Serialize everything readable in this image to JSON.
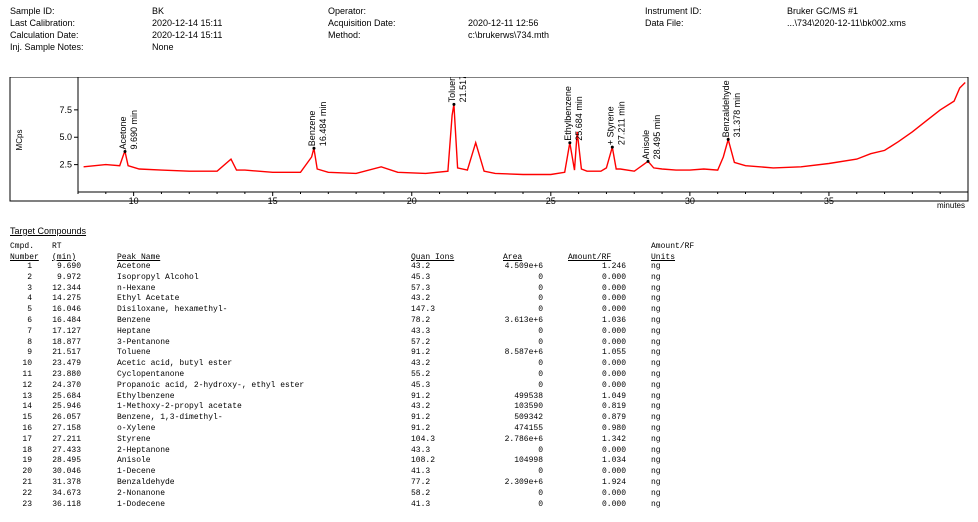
{
  "header": {
    "left": [
      {
        "label": "Sample ID:",
        "value": "BK"
      },
      {
        "label": "Last Calibration:",
        "value": "2020-12-14 15:11"
      },
      {
        "label": "Calculation Date:",
        "value": "2020-12-14 15:11"
      },
      {
        "label": "Inj. Sample Notes:",
        "value": "None"
      }
    ],
    "middle": [
      {
        "label": "Operator:",
        "value": ""
      },
      {
        "label": "Acquisition Date:",
        "value": "2020-12-11 12:56"
      },
      {
        "label": "Method:",
        "value": "c:\\brukerws\\734.mth"
      }
    ],
    "right": [
      {
        "label": "Instrument ID:",
        "value": "Bruker GC/MS #1"
      },
      {
        "label": "Data File:",
        "value": "...\\734\\2020-12-11\\bk002.xms"
      }
    ]
  },
  "chart_data": {
    "type": "line",
    "ylabel": "MCps",
    "xlabel": "minutes",
    "xlim": [
      8,
      40
    ],
    "ylim": [
      0,
      10.5
    ],
    "xticks": [
      10,
      15,
      20,
      25,
      30,
      35
    ],
    "yticks": [
      2.5,
      5.0,
      7.5
    ],
    "ytick_labels": [
      "2.5",
      "5.0",
      "7.5"
    ],
    "series": [
      {
        "color": "#ff0000",
        "x": [
          8.2,
          9.0,
          9.5,
          9.65,
          9.69,
          9.8,
          10.2,
          11.0,
          12.0,
          13.0,
          13.5,
          13.7,
          14.0,
          15.0,
          16.0,
          16.4,
          16.48,
          16.6,
          17.0,
          18.0,
          18.9,
          19.5,
          20.5,
          21.3,
          21.45,
          21.517,
          21.65,
          22.0,
          22.3,
          22.6,
          23.0,
          24.0,
          25.0,
          25.5,
          25.684,
          25.85,
          25.95,
          26.1,
          26.3,
          26.8,
          27.0,
          27.211,
          27.35,
          27.5,
          28.0,
          28.495,
          28.7,
          29.0,
          29.5,
          30.0,
          30.5,
          31.0,
          31.2,
          31.378,
          31.6,
          32.0,
          33.0,
          34.0,
          35.0,
          36.0,
          36.5,
          37.0,
          37.5,
          38.0,
          38.5,
          39.0,
          39.5,
          39.7,
          39.9
        ],
        "y": [
          2.3,
          2.5,
          2.4,
          3.5,
          3.7,
          2.4,
          2.1,
          2.0,
          1.9,
          1.9,
          3.0,
          2.0,
          2.0,
          1.8,
          1.8,
          3.2,
          4.0,
          2.1,
          1.8,
          1.7,
          2.3,
          1.8,
          1.7,
          1.9,
          7.0,
          8.0,
          2.2,
          2.0,
          4.5,
          1.9,
          1.7,
          1.6,
          1.6,
          1.8,
          4.5,
          2.0,
          5.5,
          2.1,
          1.9,
          1.9,
          2.2,
          4.1,
          2.1,
          2.1,
          1.9,
          2.8,
          2.2,
          2.1,
          2.0,
          2.0,
          2.1,
          2.0,
          3.2,
          4.8,
          2.7,
          2.4,
          2.2,
          2.3,
          2.6,
          3.0,
          3.5,
          3.8,
          4.6,
          5.5,
          6.5,
          7.5,
          8.3,
          9.5,
          10.0
        ]
      }
    ],
    "annotations": [
      {
        "name": "Acetone",
        "rt": "9.690 min",
        "x": 9.69,
        "y": 3.7
      },
      {
        "name": "Benzene",
        "rt": "16.484 min",
        "x": 16.484,
        "y": 4.0
      },
      {
        "name": "Toluene",
        "rt": "21.517 min",
        "x": 21.517,
        "y": 8.0
      },
      {
        "name": "Ethylbenzene",
        "rt": "25.684 min",
        "x": 25.684,
        "y": 4.5
      },
      {
        "name": "+ Styrene",
        "rt": "27.211 min",
        "x": 27.211,
        "y": 4.1
      },
      {
        "name": "Anisole",
        "rt": "28.495 min",
        "x": 28.495,
        "y": 2.8
      },
      {
        "name": "Benzaldehyde",
        "rt": "31.378 min",
        "x": 31.378,
        "y": 4.8
      }
    ]
  },
  "section_title": "Target Compounds",
  "columns": {
    "top": [
      "Cmpd.",
      "RT",
      "",
      "",
      "",
      "Amount/RF"
    ],
    "bottom": [
      "Number",
      "(min)",
      "Peak Name",
      "Quan Ions",
      "Area",
      "Amount/RF",
      "Units"
    ]
  },
  "rows": [
    {
      "n": "1",
      "rt": "9.690",
      "name": "Acetone",
      "ions": "43.2",
      "area": "4.509e+6",
      "amt": "1.246",
      "unit": "ng"
    },
    {
      "n": "2",
      "rt": "9.972",
      "name": "Isopropyl Alcohol",
      "ions": "45.3",
      "area": "0",
      "amt": "0.000",
      "unit": "ng"
    },
    {
      "n": "3",
      "rt": "12.344",
      "name": "n-Hexane",
      "ions": "57.3",
      "area": "0",
      "amt": "0.000",
      "unit": "ng"
    },
    {
      "n": "4",
      "rt": "14.275",
      "name": "Ethyl Acetate",
      "ions": "43.2",
      "area": "0",
      "amt": "0.000",
      "unit": "ng"
    },
    {
      "n": "5",
      "rt": "16.046",
      "name": "Disiloxane, hexamethyl-",
      "ions": "147.3",
      "area": "0",
      "amt": "0.000",
      "unit": "ng"
    },
    {
      "n": "6",
      "rt": "16.484",
      "name": "Benzene",
      "ions": "78.2",
      "area": "3.613e+6",
      "amt": "1.036",
      "unit": "ng"
    },
    {
      "n": "7",
      "rt": "17.127",
      "name": "Heptane",
      "ions": "43.3",
      "area": "0",
      "amt": "0.000",
      "unit": "ng"
    },
    {
      "n": "8",
      "rt": "18.877",
      "name": "3-Pentanone",
      "ions": "57.2",
      "area": "0",
      "amt": "0.000",
      "unit": "ng"
    },
    {
      "n": "9",
      "rt": "21.517",
      "name": "Toluene",
      "ions": "91.2",
      "area": "8.587e+6",
      "amt": "1.055",
      "unit": "ng"
    },
    {
      "n": "10",
      "rt": "23.479",
      "name": "Acetic acid, butyl ester",
      "ions": "43.2",
      "area": "0",
      "amt": "0.000",
      "unit": "ng"
    },
    {
      "n": "11",
      "rt": "23.880",
      "name": "Cyclopentanone",
      "ions": "55.2",
      "area": "0",
      "amt": "0.000",
      "unit": "ng"
    },
    {
      "n": "12",
      "rt": "24.370",
      "name": "Propanoic acid, 2-hydroxy-, ethyl ester",
      "ions": "45.3",
      "area": "0",
      "amt": "0.000",
      "unit": "ng"
    },
    {
      "n": "13",
      "rt": "25.684",
      "name": "Ethylbenzene",
      "ions": "91.2",
      "area": "499538",
      "amt": "1.049",
      "unit": "ng"
    },
    {
      "n": "14",
      "rt": "25.946",
      "name": "1-Methoxy-2-propyl acetate",
      "ions": "43.2",
      "area": "103590",
      "amt": "0.819",
      "unit": "ng"
    },
    {
      "n": "15",
      "rt": "26.057",
      "name": "Benzene, 1,3-dimethyl-",
      "ions": "91.2",
      "area": "509342",
      "amt": "0.879",
      "unit": "ng"
    },
    {
      "n": "16",
      "rt": "27.158",
      "name": "o-Xylene",
      "ions": "91.2",
      "area": "474155",
      "amt": "0.980",
      "unit": "ng"
    },
    {
      "n": "17",
      "rt": "27.211",
      "name": "Styrene",
      "ions": "104.3",
      "area": "2.786e+6",
      "amt": "1.342",
      "unit": "ng"
    },
    {
      "n": "18",
      "rt": "27.433",
      "name": "2-Heptanone",
      "ions": "43.3",
      "area": "0",
      "amt": "0.000",
      "unit": "ng"
    },
    {
      "n": "19",
      "rt": "28.495",
      "name": "Anisole",
      "ions": "108.2",
      "area": "104998",
      "amt": "1.034",
      "unit": "ng"
    },
    {
      "n": "20",
      "rt": "30.046",
      "name": "1-Decene",
      "ions": "41.3",
      "area": "0",
      "amt": "0.000",
      "unit": "ng"
    },
    {
      "n": "21",
      "rt": "31.378",
      "name": "Benzaldehyde",
      "ions": "77.2",
      "area": "2.309e+6",
      "amt": "1.924",
      "unit": "ng"
    },
    {
      "n": "22",
      "rt": "34.673",
      "name": "2-Nonanone",
      "ions": "58.2",
      "area": "0",
      "amt": "0.000",
      "unit": "ng"
    },
    {
      "n": "23",
      "rt": "36.118",
      "name": "1-Dodecene",
      "ions": "41.3",
      "area": "0",
      "amt": "0.000",
      "unit": "ng"
    }
  ]
}
